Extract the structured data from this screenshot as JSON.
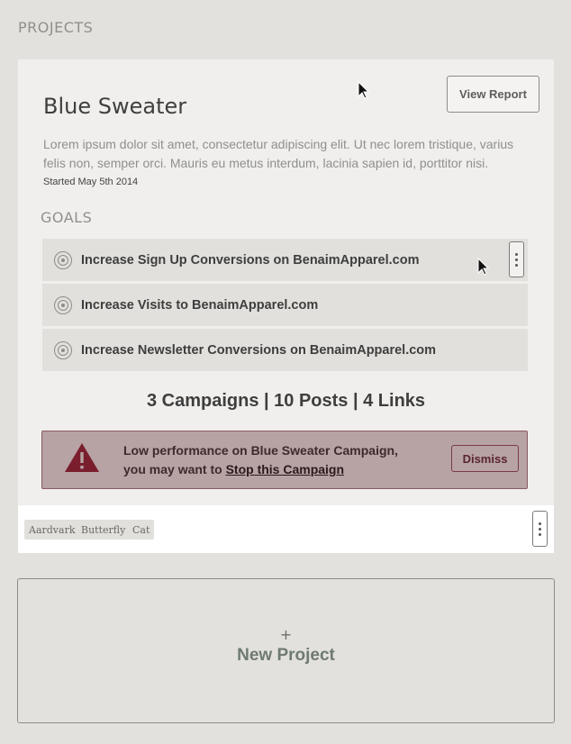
{
  "section": {
    "label": "PROJECTS"
  },
  "project": {
    "title": "Blue Sweater",
    "view_report_label": "View Report",
    "description": "Lorem ipsum dolor sit amet, consectetur adipiscing elit. Ut nec lorem tristique, varius felis non, semper orci. Mauris eu metus interdum, lacinia sapien id, porttitor nisi.",
    "started": "Started May 5th 2014",
    "goals_label": "GOALS",
    "goals": [
      {
        "label": "Increase Sign Up Conversions on BenaimApparel.com",
        "icon": "target-icon"
      },
      {
        "label": "Increase Visits to BenaimApparel.com",
        "icon": "target-icon"
      },
      {
        "label": "Increase Newsletter Conversions on BenaimApparel.com",
        "icon": "target-icon"
      }
    ],
    "stats": "3 Campaigns | 10 Posts | 4 Links",
    "alert": {
      "line1": "Low performance on Blue Sweater Campaign,",
      "line2_prefix": "you may want to ",
      "link": "Stop this Campaign",
      "dismiss_label": "Dismiss",
      "icon": "warning-icon",
      "color": "#7a1e2e"
    },
    "tags": [
      "Aardvark",
      "Butterfly",
      "Cat"
    ]
  },
  "new_project": {
    "plus": "+",
    "label": "New Project"
  }
}
